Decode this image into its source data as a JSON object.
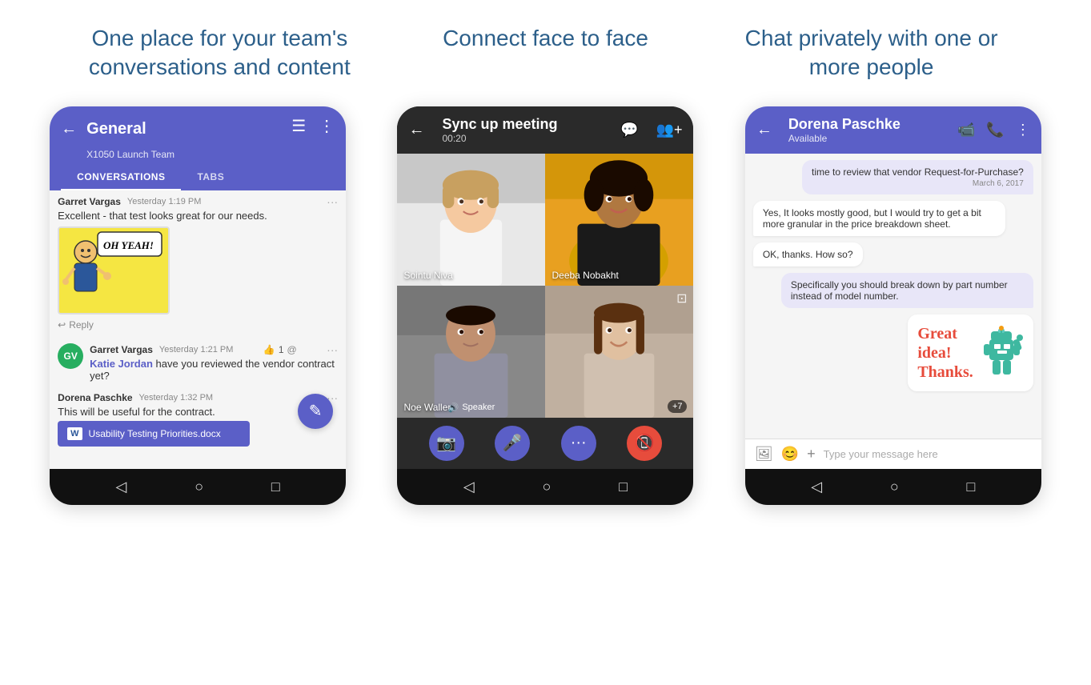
{
  "headings": {
    "h1": "One place for your team's conversations and content",
    "h2": "Connect face to face",
    "h3": "Chat privately with one or more people"
  },
  "phone1": {
    "header_title": "General",
    "header_subtitle": "X1050 Launch Team",
    "tab1": "CONVERSATIONS",
    "tab2": "TABS",
    "msg1_name": "Garret Vargas",
    "msg1_time": "Yesterday 1:19 PM",
    "msg1_text": "Excellent - that test looks great for our needs.",
    "sticker_text": "OH YEAH!",
    "reply_label": "Reply",
    "msg2_name": "Garret Vargas",
    "msg2_time": "Yesterday 1:21 PM",
    "msg2_text": " have you reviewed the vendor contract yet?",
    "msg2_mention": "Katie Jordan",
    "msg3_name": "Dorena Paschke",
    "msg3_time": "Yesterday 1:32 PM",
    "msg3_text": "This will be useful for the contract.",
    "file_name": "Usability Testing  Priorities.docx"
  },
  "phone2": {
    "header_title": "Sync up meeting",
    "timer": "00:20",
    "person1_name": "Sointu Niva",
    "person2_name": "Deeba Nobakht",
    "person3_name": "Noe Wallen",
    "person4_name": "",
    "speaker_label": "Speaker",
    "plus_badge": "+7"
  },
  "phone3": {
    "contact_name": "Dorena Paschke",
    "status": "Available",
    "msg1": "time to review that vendor Request-for-Purchase?",
    "msg1_date": "March 6, 2017",
    "msg2": "Yes, It looks mostly good, but I would try to get a bit more granular in the price breakdown sheet.",
    "msg3": "OK, thanks. How so?",
    "msg4": "Specifically you should break down by part number instead of model number.",
    "sticker_text1": "Great",
    "sticker_text2": "idea!",
    "sticker_text3": "Thanks.",
    "input_placeholder": "Type your message here"
  },
  "icons": {
    "back": "←",
    "menu": "⋮",
    "compose": "✎",
    "chat": "💬",
    "people_add": "👥",
    "video": "📹",
    "phone": "📞",
    "image": "🖼",
    "emoji": "😊",
    "plus": "+",
    "screen_share": "🖥",
    "back_triangle": "◁",
    "home_circle": "○",
    "square": "□"
  }
}
